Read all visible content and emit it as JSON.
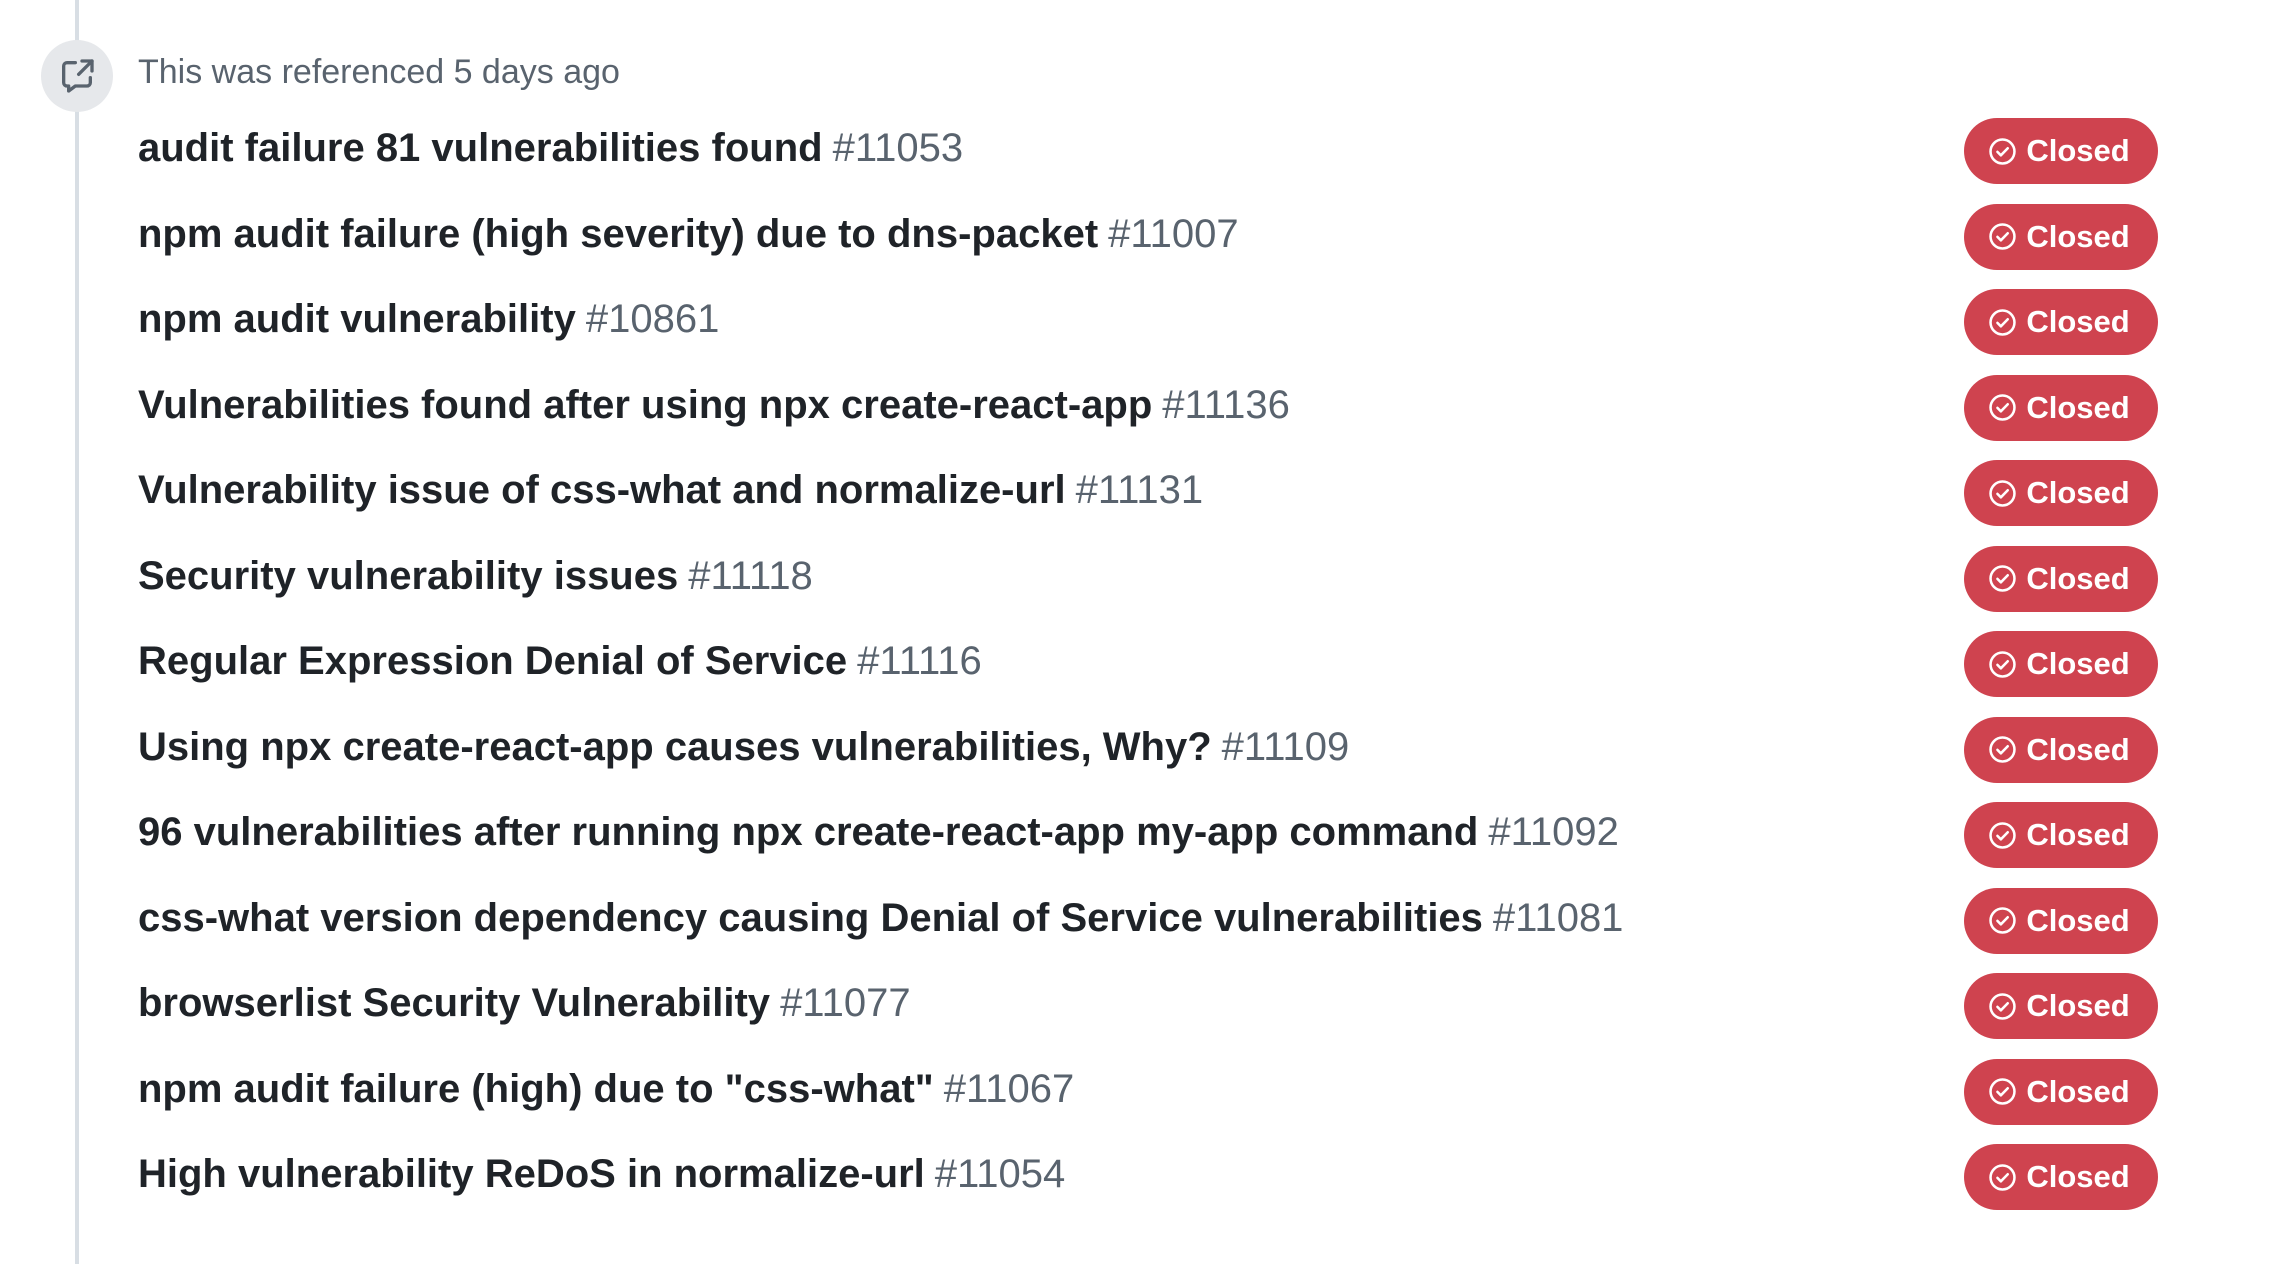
{
  "timeline_event": {
    "icon": "cross-reference-icon",
    "header": "This was referenced 5 days ago"
  },
  "colors": {
    "closed_badge": "#cf434f",
    "title": "#1f2328",
    "muted": "#59636e",
    "badge_circle": "#e6e8eb"
  },
  "references": [
    {
      "title": "audit failure 81 vulnerabilities found",
      "number": "#11053",
      "state": "Closed"
    },
    {
      "title": "npm audit failure (high severity) due to dns-packet",
      "number": "#11007",
      "state": "Closed"
    },
    {
      "title": "npm audit vulnerability",
      "number": "#10861",
      "state": "Closed"
    },
    {
      "title": "Vulnerabilities found after using npx create-react-app",
      "number": "#11136",
      "state": "Closed"
    },
    {
      "title": "Vulnerability issue of css-what and normalize-url",
      "number": "#11131",
      "state": "Closed"
    },
    {
      "title": "Security vulnerability issues",
      "number": "#11118",
      "state": "Closed"
    },
    {
      "title": "Regular Expression Denial of Service",
      "number": "#11116",
      "state": "Closed"
    },
    {
      "title": "Using npx create-react-app causes vulnerabilities, Why?",
      "number": "#11109",
      "state": "Closed"
    },
    {
      "title": "96 vulnerabilities after running npx create-react-app my-app command",
      "number": "#11092",
      "state": "Closed"
    },
    {
      "title": "css-what version dependency causing Denial of Service vulnerabilities",
      "number": "#11081",
      "state": "Closed"
    },
    {
      "title": "browserlist Security Vulnerability",
      "number": "#11077",
      "state": "Closed"
    },
    {
      "title": "npm audit failure (high) due to \"css-what\"",
      "number": "#11067",
      "state": "Closed"
    },
    {
      "title": "High vulnerability ReDoS in normalize-url",
      "number": "#11054",
      "state": "Closed"
    }
  ]
}
